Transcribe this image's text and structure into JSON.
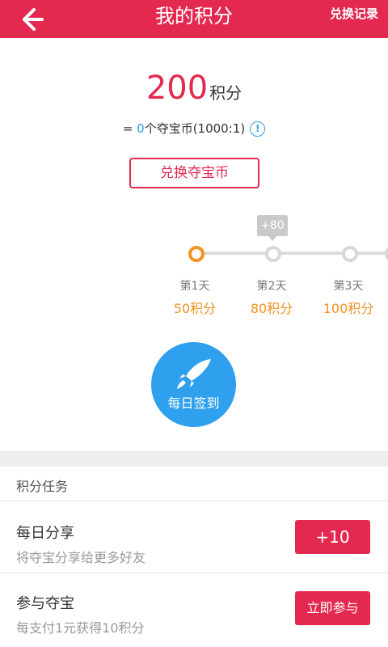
{
  "header": {
    "title": "我的积分",
    "exchange_record": "兑换记录"
  },
  "points": {
    "value": "200",
    "unit": "积分",
    "coins_prefix": "= ",
    "coins_value": "0",
    "coins_suffix": "个夺宝币(1000:1)",
    "info_icon": "!",
    "exchange_button": "兑换夺宝币"
  },
  "checkin": {
    "tooltip": "+80",
    "days": [
      {
        "label": "第1天",
        "points": "50积分",
        "active": true
      },
      {
        "label": "第2天",
        "points": "80积分",
        "active": false
      },
      {
        "label": "第3天",
        "points": "100积分",
        "active": false
      }
    ],
    "sign_button": "每日签到"
  },
  "tasks": {
    "section_title": "积分任务",
    "items": [
      {
        "title": "每日分享",
        "desc": "将夺宝分享给更多好友",
        "button": "+10"
      },
      {
        "title": "参与夺宝",
        "desc": "每支付1元获得10积分",
        "button": "立即参与"
      }
    ]
  },
  "colors": {
    "brand": "#e3294f",
    "accent_orange": "#f39222",
    "accent_blue": "#2fa0ee"
  },
  "icons": {
    "back": "back-arrow-icon",
    "info": "info-icon",
    "sign": "rocket-icon"
  }
}
